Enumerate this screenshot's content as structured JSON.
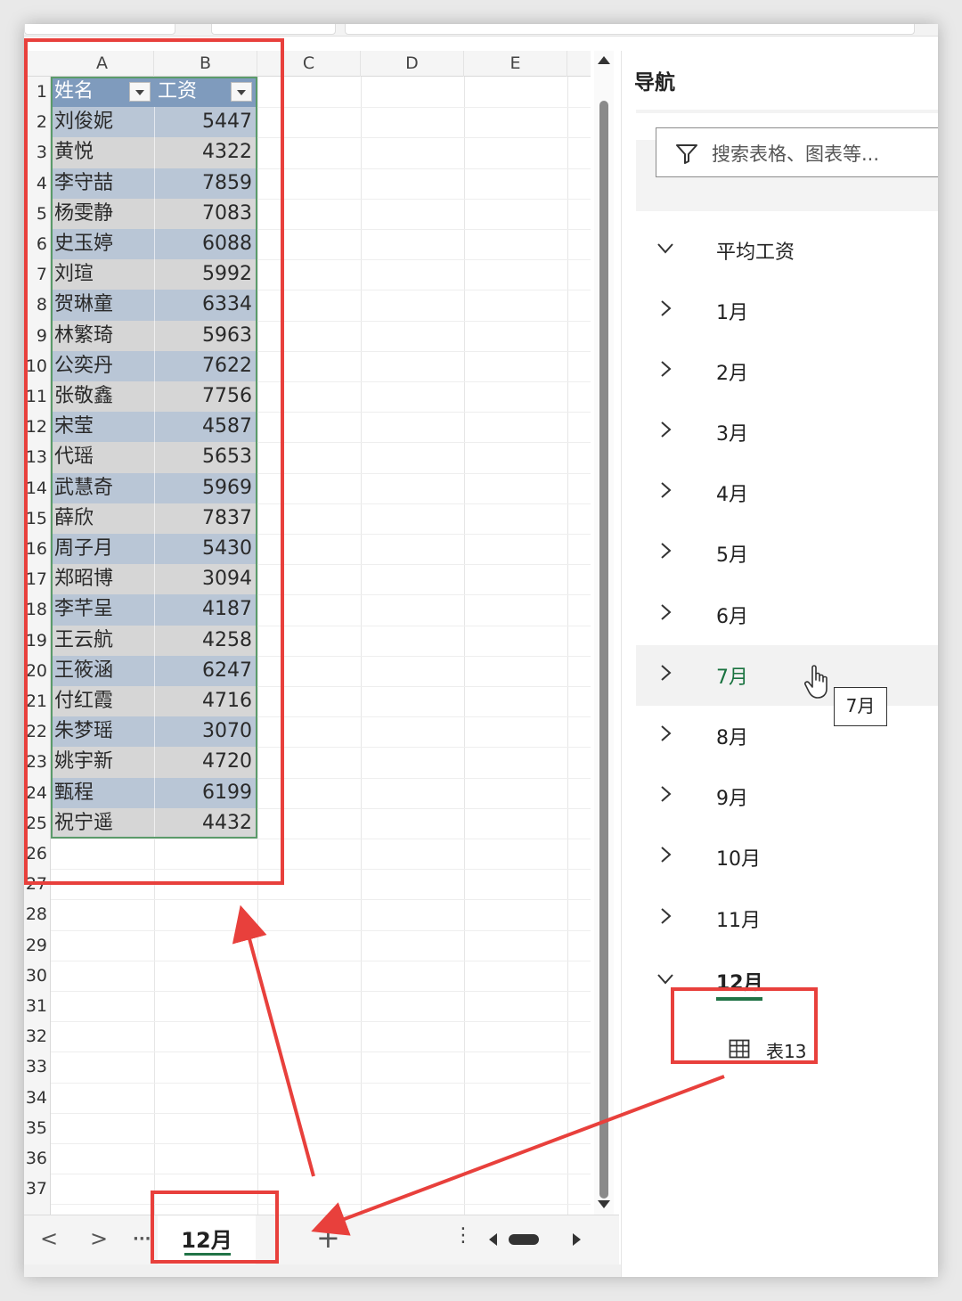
{
  "columns": [
    "A",
    "B",
    "C",
    "D",
    "E"
  ],
  "row_numbers": [
    "1",
    "2",
    "3",
    "4",
    "5",
    "6",
    "7",
    "8",
    "9",
    "10",
    "11",
    "12",
    "13",
    "14",
    "15",
    "16",
    "17",
    "18",
    "19",
    "20",
    "21",
    "22",
    "23",
    "24",
    "25",
    "26",
    "27",
    "28",
    "29",
    "30",
    "31",
    "32",
    "33",
    "34",
    "35",
    "36",
    "37"
  ],
  "table": {
    "headers": [
      "姓名",
      "工资"
    ],
    "rows": [
      [
        "刘俊妮",
        "5447"
      ],
      [
        "黄悦",
        "4322"
      ],
      [
        "李守喆",
        "7859"
      ],
      [
        "杨雯静",
        "7083"
      ],
      [
        "史玉婷",
        "6088"
      ],
      [
        "刘瑄",
        "5992"
      ],
      [
        "贺琳童",
        "6334"
      ],
      [
        "林繁琦",
        "5963"
      ],
      [
        "公奕丹",
        "7622"
      ],
      [
        "张敬鑫",
        "7756"
      ],
      [
        "宋莹",
        "4587"
      ],
      [
        "代瑶",
        "5653"
      ],
      [
        "武慧奇",
        "5969"
      ],
      [
        "薛欣",
        "7837"
      ],
      [
        "周子月",
        "5430"
      ],
      [
        "郑昭博",
        "3094"
      ],
      [
        "李芊呈",
        "4187"
      ],
      [
        "王云航",
        "4258"
      ],
      [
        "王筱涵",
        "6247"
      ],
      [
        "付红霞",
        "4716"
      ],
      [
        "朱梦瑶",
        "3070"
      ],
      [
        "姚宇新",
        "4720"
      ],
      [
        "甄程",
        "6199"
      ],
      [
        "祝宁遥",
        "4432"
      ]
    ]
  },
  "sheet_tabs": {
    "prev": "<",
    "next": ">",
    "more": "···",
    "active_label": "12月",
    "add": "+",
    "options": "⋮"
  },
  "nav_pane": {
    "title": "导航",
    "search_placeholder": "搜索表格、图表等...",
    "items": [
      {
        "label": "平均工资",
        "expanded": true
      },
      {
        "label": "1月",
        "expanded": false
      },
      {
        "label": "2月",
        "expanded": false
      },
      {
        "label": "3月",
        "expanded": false
      },
      {
        "label": "4月",
        "expanded": false
      },
      {
        "label": "5月",
        "expanded": false
      },
      {
        "label": "6月",
        "expanded": false
      },
      {
        "label": "7月",
        "expanded": false
      },
      {
        "label": "8月",
        "expanded": false
      },
      {
        "label": "9月",
        "expanded": false
      },
      {
        "label": "10月",
        "expanded": false
      },
      {
        "label": "11月",
        "expanded": false
      },
      {
        "label": "12月",
        "expanded": true
      }
    ],
    "child_label": "表13",
    "tooltip": "7月"
  },
  "colors": {
    "accent_green": "#217346",
    "table_header": "#7f9bbd",
    "table_band": "#b9c6d6",
    "annotation_red": "#e8403c"
  },
  "icons": {
    "filter": "funnel-icon",
    "expand": "chevron-right-icon",
    "collapse": "chevron-down-icon",
    "table": "table-icon",
    "pointer": "hand-cursor-icon"
  }
}
